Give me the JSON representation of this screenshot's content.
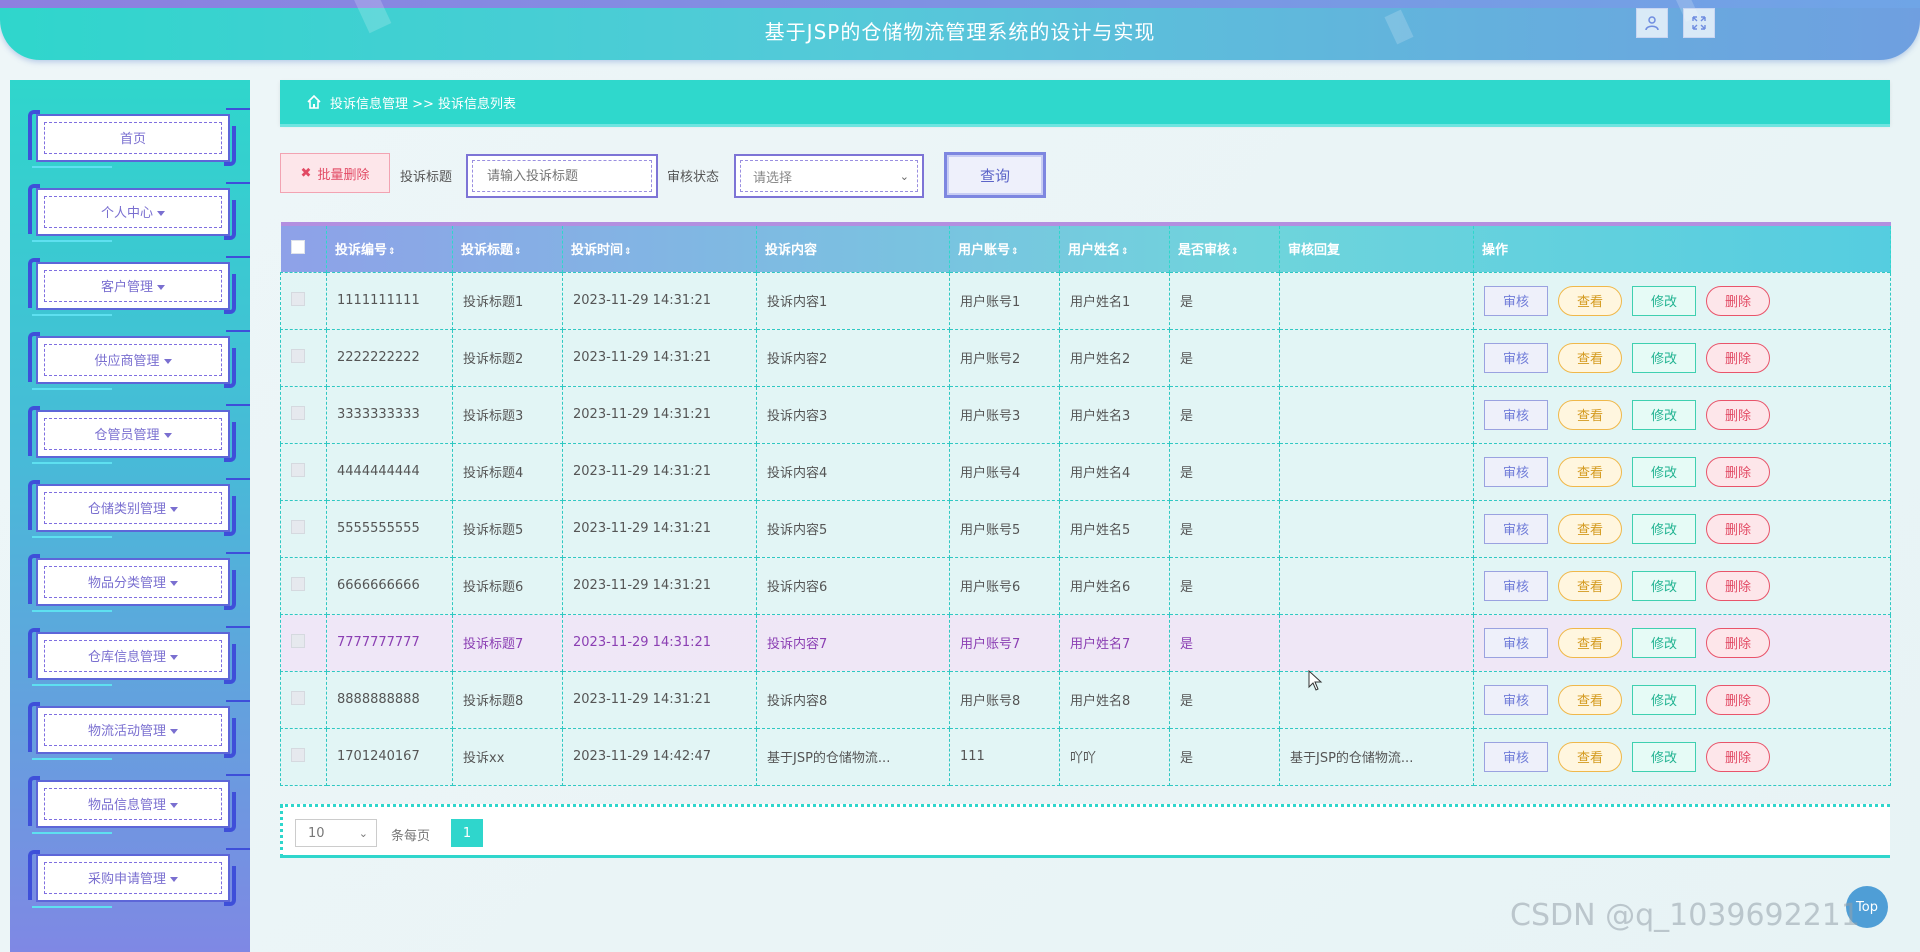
{
  "header": {
    "title": "基于JSP的仓储物流管理系统的设计与实现",
    "user_icon": "user-icon",
    "fullscreen_icon": "fullscreen-icon"
  },
  "sidebar": {
    "items": [
      {
        "label": "首页",
        "dropdown": false
      },
      {
        "label": "个人中心",
        "dropdown": true
      },
      {
        "label": "客户管理",
        "dropdown": true
      },
      {
        "label": "供应商管理",
        "dropdown": true
      },
      {
        "label": "仓管员管理",
        "dropdown": true
      },
      {
        "label": "仓储类别管理",
        "dropdown": true
      },
      {
        "label": "物品分类管理",
        "dropdown": true
      },
      {
        "label": "仓库信息管理",
        "dropdown": true
      },
      {
        "label": "物流活动管理",
        "dropdown": true
      },
      {
        "label": "物品信息管理",
        "dropdown": true
      },
      {
        "label": "采购申请管理",
        "dropdown": true
      }
    ]
  },
  "breadcrumb": {
    "text": "投诉信息管理 >> 投诉信息列表"
  },
  "toolbar": {
    "batch_delete": "批量删除",
    "title_label": "投诉标题",
    "title_placeholder": "请输入投诉标题",
    "status_label": "审核状态",
    "status_value": "请选择",
    "query_button": "查询"
  },
  "table": {
    "headers": [
      "投诉编号",
      "投诉标题",
      "投诉时间",
      "投诉内容",
      "用户账号",
      "用户姓名",
      "是否审核",
      "审核回复",
      "操作"
    ],
    "sortable": [
      true,
      true,
      true,
      false,
      true,
      true,
      true,
      false,
      false
    ],
    "sort_glyph": "⇕",
    "rows": [
      [
        "1111111111",
        "投诉标题1",
        "2023-11-29 14:31:21",
        "投诉内容1",
        "用户账号1",
        "用户姓名1",
        "是",
        ""
      ],
      [
        "2222222222",
        "投诉标题2",
        "2023-11-29 14:31:21",
        "投诉内容2",
        "用户账号2",
        "用户姓名2",
        "是",
        ""
      ],
      [
        "3333333333",
        "投诉标题3",
        "2023-11-29 14:31:21",
        "投诉内容3",
        "用户账号3",
        "用户姓名3",
        "是",
        ""
      ],
      [
        "4444444444",
        "投诉标题4",
        "2023-11-29 14:31:21",
        "投诉内容4",
        "用户账号4",
        "用户姓名4",
        "是",
        ""
      ],
      [
        "5555555555",
        "投诉标题5",
        "2023-11-29 14:31:21",
        "投诉内容5",
        "用户账号5",
        "用户姓名5",
        "是",
        ""
      ],
      [
        "6666666666",
        "投诉标题6",
        "2023-11-29 14:31:21",
        "投诉内容6",
        "用户账号6",
        "用户姓名6",
        "是",
        ""
      ],
      [
        "7777777777",
        "投诉标题7",
        "2023-11-29 14:31:21",
        "投诉内容7",
        "用户账号7",
        "用户姓名7",
        "是",
        ""
      ],
      [
        "8888888888",
        "投诉标题8",
        "2023-11-29 14:31:21",
        "投诉内容8",
        "用户账号8",
        "用户姓名8",
        "是",
        ""
      ],
      [
        "1701240167",
        "投诉xx",
        "2023-11-29 14:42:47",
        "基于JSP的仓储物流...",
        "111",
        "吖吖",
        "是",
        "基于JSP的仓储物流..."
      ]
    ],
    "highlight_row": 6,
    "actions": {
      "audit": "审核",
      "view": "查看",
      "edit": "修改",
      "delete": "删除"
    }
  },
  "pagination": {
    "page_size": "10",
    "per_page_label": "条每页",
    "current_page": "1"
  },
  "top_button": "Top",
  "watermark": "CSDN @q_1039692211",
  "colors": {
    "accent": "#2fd6cc",
    "purple": "#7d74d6",
    "danger": "#e24a64",
    "warning": "#d49a1f",
    "success": "#21b391"
  }
}
